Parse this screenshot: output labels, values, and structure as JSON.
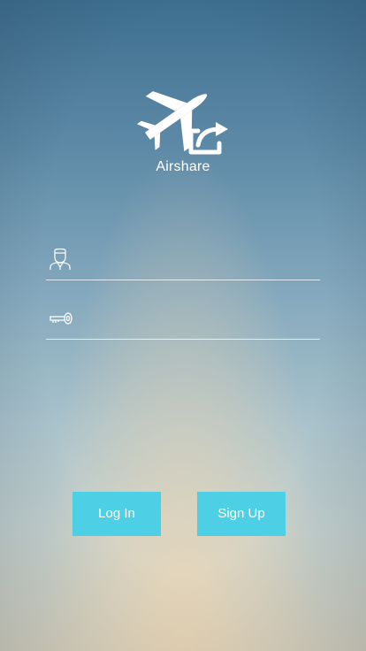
{
  "app": {
    "name": "Airshare"
  },
  "form": {
    "username": {
      "value": "",
      "placeholder": "",
      "icon": "user-icon"
    },
    "password": {
      "value": "",
      "placeholder": "",
      "icon": "key-icon"
    }
  },
  "buttons": {
    "login_label": "Log In",
    "signup_label": "Sign Up"
  },
  "colors": {
    "accent": "#4dd0e5",
    "text": "#ffffff"
  }
}
